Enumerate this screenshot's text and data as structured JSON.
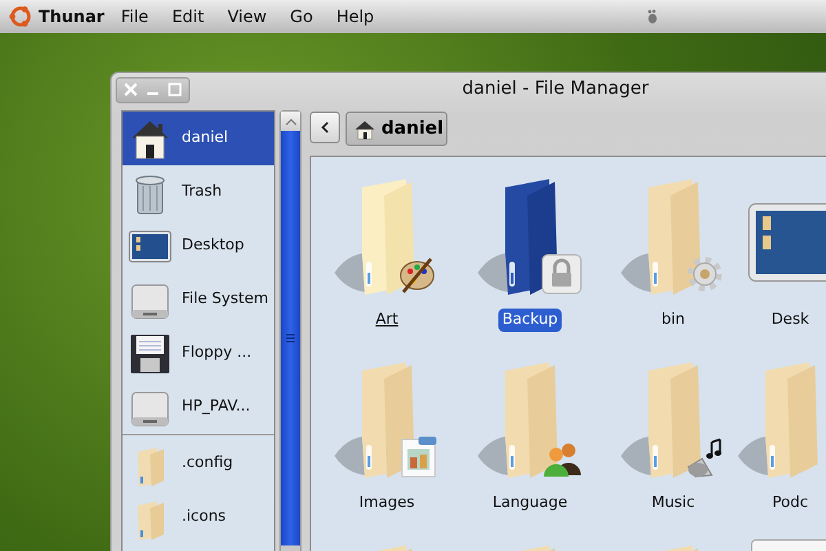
{
  "menubar": {
    "app_name": "Thunar",
    "menus": [
      "File",
      "Edit",
      "View",
      "Go",
      "Help"
    ]
  },
  "window": {
    "title": "daniel - File Manager"
  },
  "sidebar": {
    "sections": [
      [
        {
          "label": "daniel",
          "kind": "home",
          "selected": true
        },
        {
          "label": "Trash",
          "kind": "trash",
          "selected": false
        },
        {
          "label": "Desktop",
          "kind": "desktop",
          "selected": false
        },
        {
          "label": "File System",
          "kind": "drive",
          "selected": false
        },
        {
          "label": "Floppy ...",
          "kind": "floppy",
          "selected": false
        },
        {
          "label": "HP_PAV...",
          "kind": "drive",
          "selected": false
        }
      ],
      [
        {
          "label": ".config",
          "kind": "folder",
          "selected": false
        },
        {
          "label": ".icons",
          "kind": "folder",
          "selected": false
        }
      ]
    ]
  },
  "toolbar": {
    "path_button": "daniel"
  },
  "items": [
    {
      "label": "Art",
      "kind": "art",
      "selected": false,
      "focused": true
    },
    {
      "label": "Backup",
      "kind": "locked",
      "selected": true,
      "focused": false
    },
    {
      "label": "bin",
      "kind": "system",
      "selected": false,
      "focused": false
    },
    {
      "label": "Desk",
      "kind": "desktop",
      "selected": false,
      "focused": false
    },
    {
      "label": "Images",
      "kind": "images",
      "selected": false,
      "focused": false
    },
    {
      "label": "Language",
      "kind": "people",
      "selected": false,
      "focused": false
    },
    {
      "label": "Music",
      "kind": "music",
      "selected": false,
      "focused": false
    },
    {
      "label": "Podc",
      "kind": "folder",
      "selected": false,
      "focused": false
    },
    {
      "kind": "folder"
    },
    {
      "kind": "folder"
    },
    {
      "kind": "folder"
    },
    {
      "kind": "file"
    }
  ]
}
